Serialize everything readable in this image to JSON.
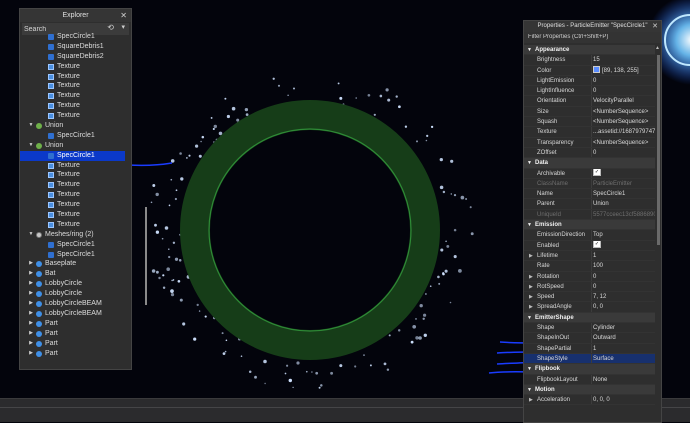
{
  "explorer": {
    "title": "Explorer",
    "search_placeholder": "Search",
    "items": [
      {
        "label": "SpecCircle1",
        "indent": 2,
        "icon": "particle-emitter-icon",
        "arrow": "",
        "selected": false
      },
      {
        "label": "SquareDebris1",
        "indent": 2,
        "icon": "particle-emitter-icon",
        "arrow": "",
        "selected": false
      },
      {
        "label": "SquareDebris2",
        "indent": 2,
        "icon": "particle-emitter-icon",
        "arrow": "",
        "selected": false
      },
      {
        "label": "Texture",
        "indent": 2,
        "icon": "texture-icon",
        "arrow": "",
        "selected": false
      },
      {
        "label": "Texture",
        "indent": 2,
        "icon": "texture-icon",
        "arrow": "",
        "selected": false
      },
      {
        "label": "Texture",
        "indent": 2,
        "icon": "texture-icon",
        "arrow": "",
        "selected": false
      },
      {
        "label": "Texture",
        "indent": 2,
        "icon": "texture-icon",
        "arrow": "",
        "selected": false
      },
      {
        "label": "Texture",
        "indent": 2,
        "icon": "texture-icon",
        "arrow": "",
        "selected": false
      },
      {
        "label": "Texture",
        "indent": 2,
        "icon": "texture-icon",
        "arrow": "",
        "selected": false
      },
      {
        "label": "Union",
        "indent": 1,
        "icon": "union-icon",
        "arrow": "▼",
        "selected": false
      },
      {
        "label": "SpecCircle1",
        "indent": 2,
        "icon": "particle-emitter-icon",
        "arrow": "",
        "selected": false
      },
      {
        "label": "Union",
        "indent": 1,
        "icon": "union-icon",
        "arrow": "▼",
        "selected": false
      },
      {
        "label": "SpecCircle1",
        "indent": 2,
        "icon": "particle-emitter-icon",
        "arrow": "",
        "selected": true
      },
      {
        "label": "Texture",
        "indent": 2,
        "icon": "texture-icon",
        "arrow": "",
        "selected": false
      },
      {
        "label": "Texture",
        "indent": 2,
        "icon": "texture-icon",
        "arrow": "",
        "selected": false
      },
      {
        "label": "Texture",
        "indent": 2,
        "icon": "texture-icon",
        "arrow": "",
        "selected": false
      },
      {
        "label": "Texture",
        "indent": 2,
        "icon": "texture-icon",
        "arrow": "",
        "selected": false
      },
      {
        "label": "Texture",
        "indent": 2,
        "icon": "texture-icon",
        "arrow": "",
        "selected": false
      },
      {
        "label": "Texture",
        "indent": 2,
        "icon": "texture-icon",
        "arrow": "",
        "selected": false
      },
      {
        "label": "Texture",
        "indent": 2,
        "icon": "texture-icon",
        "arrow": "",
        "selected": false
      },
      {
        "label": "Meshes/ring (2)",
        "indent": 1,
        "icon": "mesh-icon",
        "arrow": "▼",
        "selected": false
      },
      {
        "label": "SpecCircle1",
        "indent": 2,
        "icon": "particle-emitter-icon",
        "arrow": "",
        "selected": false
      },
      {
        "label": "SpecCircle1",
        "indent": 2,
        "icon": "particle-emitter-icon",
        "arrow": "",
        "selected": false
      },
      {
        "label": "Baseplate",
        "indent": 1,
        "icon": "part-icon",
        "arrow": "▶",
        "selected": false
      },
      {
        "label": "Bat",
        "indent": 1,
        "icon": "part-icon",
        "arrow": "▶",
        "selected": false
      },
      {
        "label": "LobbyCircle",
        "indent": 1,
        "icon": "part-icon",
        "arrow": "▶",
        "selected": false
      },
      {
        "label": "LobbyCircle",
        "indent": 1,
        "icon": "part-icon",
        "arrow": "▶",
        "selected": false
      },
      {
        "label": "LobbyCircleBEAM",
        "indent": 1,
        "icon": "part-icon",
        "arrow": "▶",
        "selected": false
      },
      {
        "label": "LobbyCircleBEAM",
        "indent": 1,
        "icon": "part-icon",
        "arrow": "▶",
        "selected": false
      },
      {
        "label": "Part",
        "indent": 1,
        "icon": "part-icon",
        "arrow": "▶",
        "selected": false
      },
      {
        "label": "Part",
        "indent": 1,
        "icon": "part-icon",
        "arrow": "▶",
        "selected": false
      },
      {
        "label": "Part",
        "indent": 1,
        "icon": "part-icon",
        "arrow": "▶",
        "selected": false
      },
      {
        "label": "Part",
        "indent": 1,
        "icon": "part-icon",
        "arrow": "▶",
        "selected": false
      }
    ]
  },
  "properties": {
    "title": "Properties - ParticleEmitter \"SpecCircle1\"",
    "filter_placeholder": "Filter Properties (Ctrl+Shift+P)",
    "rows": [
      {
        "type": "cat",
        "label": "Appearance"
      },
      {
        "name": "Brightness",
        "value": "15"
      },
      {
        "name": "Color",
        "value": "[89, 138, 255]",
        "swatch": true
      },
      {
        "name": "LightEmission",
        "value": "0"
      },
      {
        "name": "LightInfluence",
        "value": "0"
      },
      {
        "name": "Orientation",
        "value": "VelocityParallel"
      },
      {
        "name": "Size",
        "value": "<NumberSequence>"
      },
      {
        "name": "Squash",
        "value": "<NumberSequence>"
      },
      {
        "name": "Texture",
        "value": "...assetid://16879797476"
      },
      {
        "name": "Transparency",
        "value": "<NumberSequence>"
      },
      {
        "name": "ZOffset",
        "value": "0"
      },
      {
        "type": "cat",
        "label": "Data"
      },
      {
        "name": "Archivable",
        "value": "",
        "check": true
      },
      {
        "name": "ClassName",
        "value": "ParticleEmitter",
        "dim": true
      },
      {
        "name": "Name",
        "value": "SpecCircle1"
      },
      {
        "name": "Parent",
        "value": "Union"
      },
      {
        "name": "UniqueId",
        "value": "5577cceec13cf5886890...",
        "dim": true
      },
      {
        "type": "cat",
        "label": "Emission"
      },
      {
        "name": "EmissionDirection",
        "value": "Top"
      },
      {
        "name": "Enabled",
        "value": "",
        "check": true
      },
      {
        "name": "Lifetime",
        "value": "1",
        "arrow": true
      },
      {
        "name": "Rate",
        "value": "100"
      },
      {
        "name": "Rotation",
        "value": "0",
        "arrow": true
      },
      {
        "name": "RotSpeed",
        "value": "0",
        "arrow": true
      },
      {
        "name": "Speed",
        "value": "7, 12",
        "arrow": true
      },
      {
        "name": "SpreadAngle",
        "value": "0, 0",
        "arrow": true
      },
      {
        "type": "cat",
        "label": "EmitterShape"
      },
      {
        "name": "Shape",
        "value": "Cylinder"
      },
      {
        "name": "ShapeInOut",
        "value": "Outward"
      },
      {
        "name": "ShapePartial",
        "value": "1"
      },
      {
        "name": "ShapeStyle",
        "value": "Surface",
        "selected": true
      },
      {
        "type": "cat",
        "label": "Flipbook"
      },
      {
        "name": "FlipbookLayout",
        "value": "None"
      },
      {
        "type": "cat",
        "label": "Motion"
      },
      {
        "name": "Acceleration",
        "value": "0, 0, 0",
        "arrow": true
      }
    ]
  },
  "colors": {
    "accent": "#0b39c9",
    "ring": "#1f4a1f",
    "particle": "#cfe2ff",
    "annotation": "#1a3cff"
  }
}
